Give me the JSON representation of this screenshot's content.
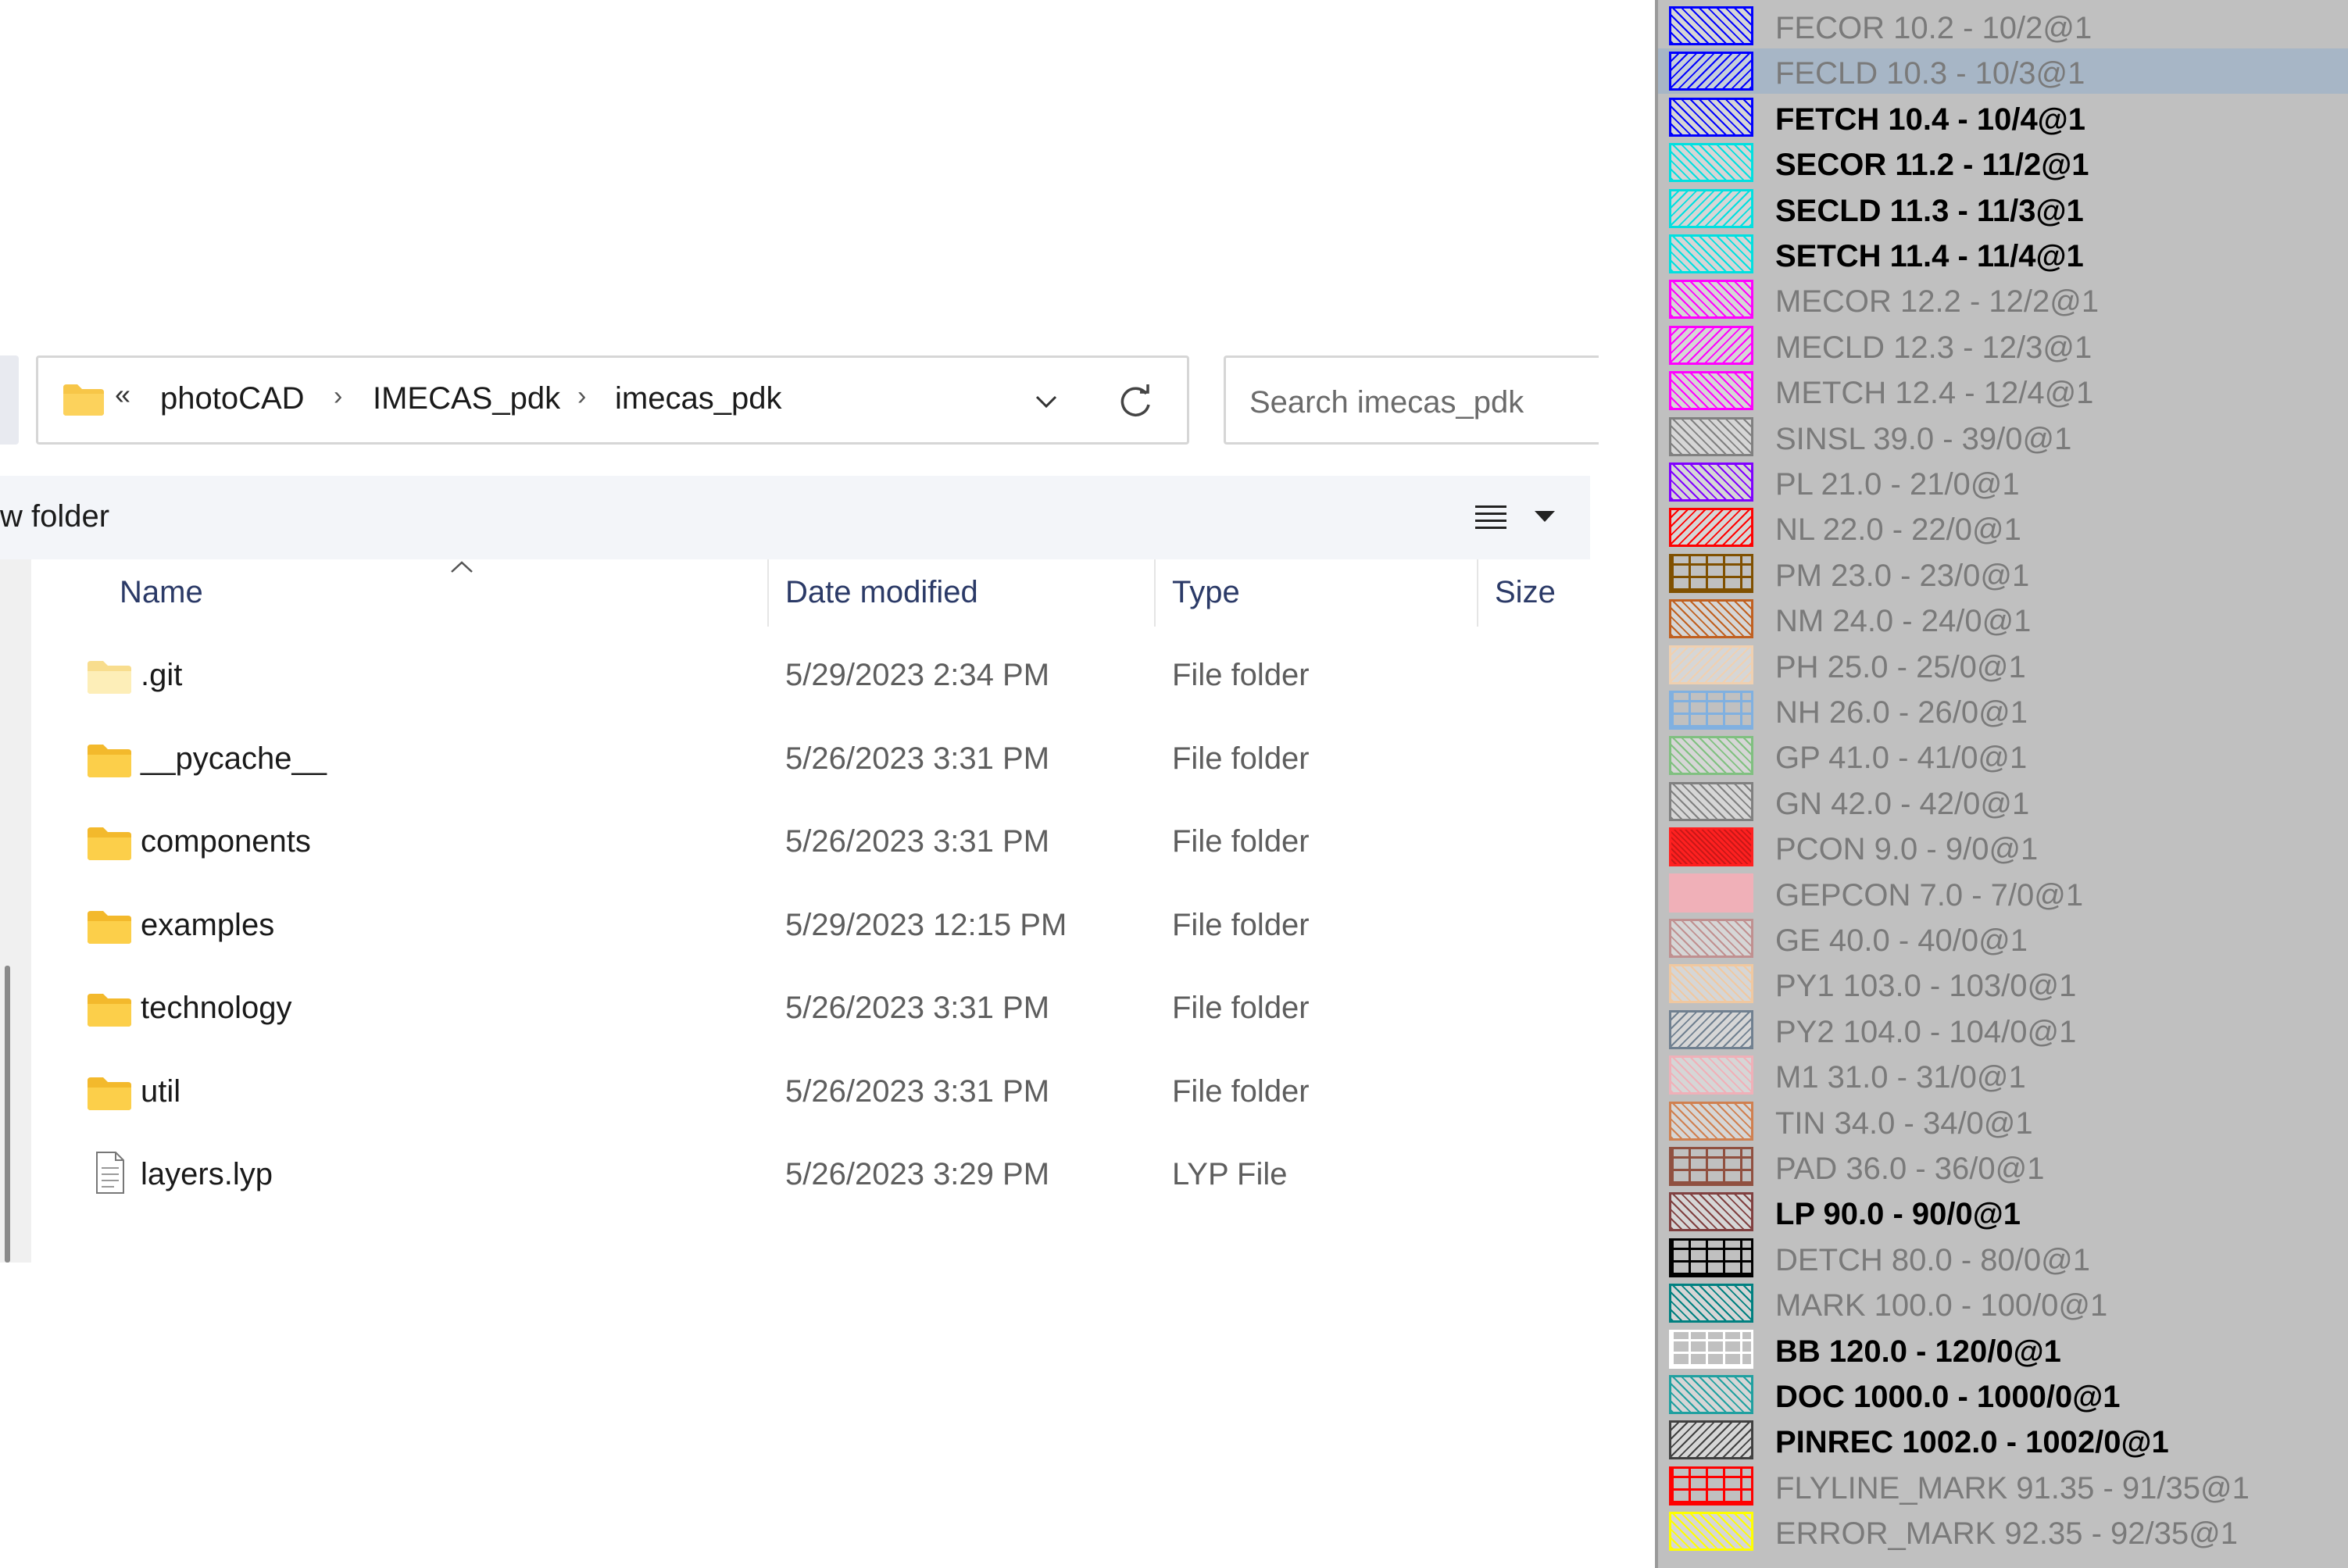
{
  "explorer": {
    "breadcrumb": [
      "photoCAD",
      "IMECAS_pdk",
      "imecas_pdk"
    ],
    "breadcrumb_overflow": "«",
    "breadcrumb_separator": "›",
    "search_placeholder": "Search imecas_pdk",
    "new_folder_label": "w folder",
    "columns": {
      "name": "Name",
      "date": "Date modified",
      "type": "Type",
      "size": "Size"
    },
    "files": [
      {
        "name": ".git",
        "date": "5/29/2023 2:34 PM",
        "type": "File folder",
        "icon": "folder-light-icon"
      },
      {
        "name": "__pycache__",
        "date": "5/26/2023 3:31 PM",
        "type": "File folder",
        "icon": "folder-icon"
      },
      {
        "name": "components",
        "date": "5/26/2023 3:31 PM",
        "type": "File folder",
        "icon": "folder-icon"
      },
      {
        "name": "examples",
        "date": "5/29/2023 12:15 PM",
        "type": "File folder",
        "icon": "folder-icon"
      },
      {
        "name": "technology",
        "date": "5/26/2023 3:31 PM",
        "type": "File folder",
        "icon": "folder-icon"
      },
      {
        "name": "util",
        "date": "5/26/2023 3:31 PM",
        "type": "File folder",
        "icon": "folder-icon"
      },
      {
        "name": "layers.lyp",
        "date": "5/26/2023 3:29 PM",
        "type": "LYP File",
        "icon": "document-icon"
      }
    ]
  },
  "layers": [
    {
      "label": "FECOR 10.2 - 10/2@1",
      "color": "#0000ff",
      "pattern": "fwd",
      "bold": false,
      "selected": false
    },
    {
      "label": "FECLD 10.3 - 10/3@1",
      "color": "#0000ff",
      "pattern": "back",
      "bold": false,
      "selected": true
    },
    {
      "label": "FETCH 10.4 - 10/4@1",
      "color": "#0000ff",
      "pattern": "fwd",
      "bold": true,
      "selected": false
    },
    {
      "label": "SECOR 11.2 - 11/2@1",
      "color": "#00e0e0",
      "pattern": "fwd",
      "bold": true,
      "selected": false
    },
    {
      "label": "SECLD 11.3 - 11/3@1",
      "color": "#00e0e0",
      "pattern": "back",
      "bold": true,
      "selected": false
    },
    {
      "label": "SETCH 11.4 - 11/4@1",
      "color": "#00e0e0",
      "pattern": "fwd",
      "bold": true,
      "selected": false
    },
    {
      "label": "MECOR 12.2 - 12/2@1",
      "color": "#ff00ff",
      "pattern": "fwd",
      "bold": false,
      "selected": false
    },
    {
      "label": "MECLD 12.3 - 12/3@1",
      "color": "#ff00ff",
      "pattern": "back",
      "bold": false,
      "selected": false
    },
    {
      "label": "METCH 12.4 - 12/4@1",
      "color": "#ff00ff",
      "pattern": "fwd",
      "bold": false,
      "selected": false
    },
    {
      "label": "SINSL 39.0 - 39/0@1",
      "color": "#808080",
      "pattern": "fwd",
      "bold": false,
      "selected": false
    },
    {
      "label": "PL 21.0 - 21/0@1",
      "color": "#8000ff",
      "pattern": "fwd",
      "bold": false,
      "selected": false
    },
    {
      "label": "NL 22.0 - 22/0@1",
      "color": "#ff0000",
      "pattern": "back",
      "bold": false,
      "selected": false
    },
    {
      "label": "PM 23.0 - 23/0@1",
      "color": "#805000",
      "pattern": "grid",
      "bold": false,
      "selected": false
    },
    {
      "label": "NM 24.0 - 24/0@1",
      "color": "#c06020",
      "pattern": "fwd",
      "bold": false,
      "selected": false
    },
    {
      "label": "PH 25.0 - 25/0@1",
      "color": "#f0d0b0",
      "pattern": "back",
      "bold": false,
      "selected": false
    },
    {
      "label": "NH 26.0 - 26/0@1",
      "color": "#80b0e0",
      "pattern": "grid",
      "bold": false,
      "selected": false
    },
    {
      "label": "GP 41.0 - 41/0@1",
      "color": "#80c080",
      "pattern": "fwd",
      "bold": false,
      "selected": false
    },
    {
      "label": "GN 42.0 - 42/0@1",
      "color": "#808080",
      "pattern": "fwd",
      "bold": false,
      "selected": false
    },
    {
      "label": "PCON 9.0 - 9/0@1",
      "color": "#ff2020",
      "pattern": "solid",
      "bold": false,
      "selected": false
    },
    {
      "label": "GEPCON 7.0 - 7/0@1",
      "color": "#f0b0b8",
      "pattern": "plain",
      "bold": false,
      "selected": false
    },
    {
      "label": "GE 40.0 - 40/0@1",
      "color": "#c09090",
      "pattern": "fwd",
      "bold": false,
      "selected": false
    },
    {
      "label": "PY1 103.0 - 103/0@1",
      "color": "#f0c8a0",
      "pattern": "fwd",
      "bold": false,
      "selected": false
    },
    {
      "label": "PY2 104.0 - 104/0@1",
      "color": "#708090",
      "pattern": "back",
      "bold": false,
      "selected": false
    },
    {
      "label": "M1 31.0 - 31/0@1",
      "color": "#f0b0b8",
      "pattern": "fwd",
      "bold": false,
      "selected": false
    },
    {
      "label": "TIN 34.0 - 34/0@1",
      "color": "#d08050",
      "pattern": "fwd",
      "bold": false,
      "selected": false
    },
    {
      "label": "PAD 36.0 - 36/0@1",
      "color": "#905040",
      "pattern": "grid",
      "bold": false,
      "selected": false
    },
    {
      "label": "LP 90.0 - 90/0@1",
      "color": "#804040",
      "pattern": "fwd",
      "bold": true,
      "selected": false
    },
    {
      "label": "DETCH 80.0 - 80/0@1",
      "color": "#000000",
      "pattern": "grid",
      "bold": false,
      "selected": false
    },
    {
      "label": "MARK 100.0 - 100/0@1",
      "color": "#008080",
      "pattern": "fwd",
      "bold": false,
      "selected": false
    },
    {
      "label": "BB 120.0 - 120/0@1",
      "color": "#ffffff",
      "pattern": "grid",
      "bold": true,
      "selected": false
    },
    {
      "label": "DOC 1000.0 - 1000/0@1",
      "color": "#20a0a0",
      "pattern": "fwd",
      "bold": true,
      "selected": false
    },
    {
      "label": "PINREC 1002.0 - 1002/0@1",
      "color": "#404040",
      "pattern": "back",
      "bold": true,
      "selected": false
    },
    {
      "label": "FLYLINE_MARK 91.35 - 91/35@1",
      "color": "#ff0000",
      "pattern": "grid",
      "bold": false,
      "selected": false
    },
    {
      "label": "ERROR_MARK 92.35 - 92/35@1",
      "color": "#ffff00",
      "pattern": "fwd",
      "bold": false,
      "selected": false
    }
  ]
}
